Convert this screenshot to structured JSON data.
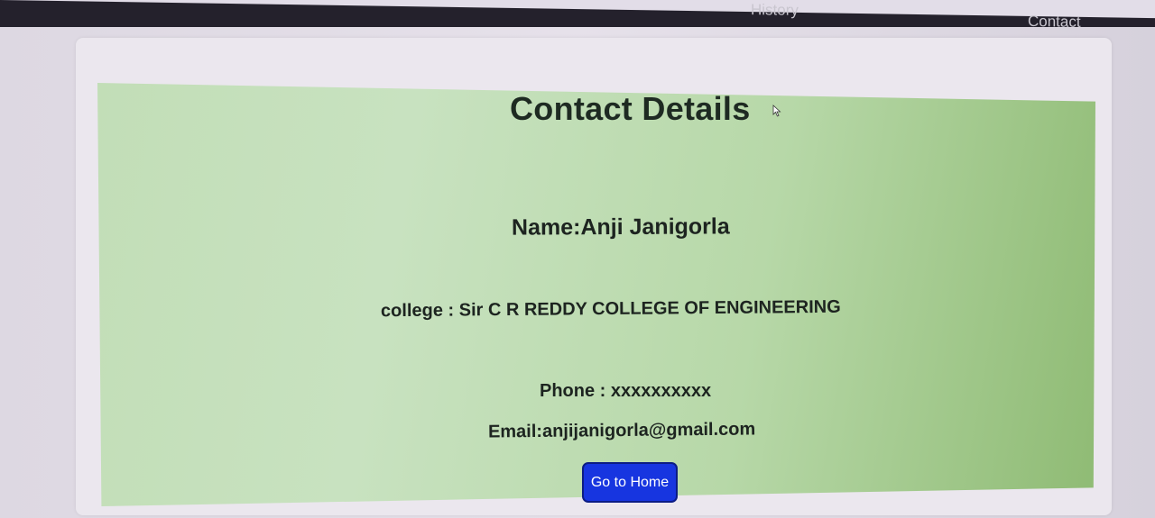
{
  "nav": {
    "items": [
      {
        "label": "History"
      },
      {
        "label": "Contact"
      }
    ]
  },
  "contact": {
    "title": "Contact Details",
    "name": "Name:Anji Janigorla",
    "college": "college : Sir C R REDDY COLLEGE OF ENGINEERING",
    "phone": "Phone : xxxxxxxxxx",
    "email": "Email:anjijanigorla@gmail.com",
    "home_button": "Go to Home"
  },
  "colors": {
    "navbar": "#24212c",
    "panel_green": "#c2deb7",
    "button_blue": "#1735e0"
  }
}
